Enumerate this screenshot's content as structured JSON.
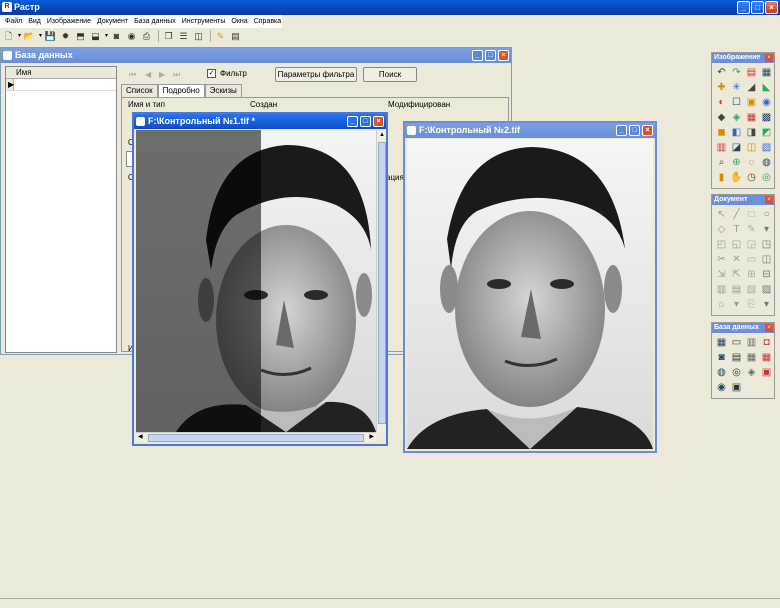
{
  "app": {
    "title": "Растр"
  },
  "menu": [
    "Файл",
    "Вид",
    "Изображение",
    "Документ",
    "База данных",
    "Инструменты",
    "Окна",
    "Справка"
  ],
  "toolbar_icons": [
    "new-file-icon",
    "open-file-icon",
    "save-icon",
    "scan-icon",
    "import-icon",
    "export-icon",
    "camera-icon",
    "disk-icon",
    "print-icon",
    "cascade-windows-icon",
    "tile-horizontal-icon",
    "tile-vertical-icon",
    "help-icon",
    "book-icon"
  ],
  "db_window": {
    "title": "База данных",
    "list_header": "Имя",
    "filter_label": "Фильтр",
    "filter_checked": true,
    "filter_params_button": "Параметры фильтра",
    "search_button": "Поиск",
    "tabs": [
      "Список",
      "Подробно",
      "Эскизы"
    ],
    "active_tab": 1,
    "fields": {
      "name_type": "Имя и тип",
      "created": "Создан",
      "modified": "Модифицирован",
      "partial_c1": "С",
      "partial_c2": "С",
      "partial_ation": "ация",
      "partial_i": "И"
    }
  },
  "image_window_1": {
    "title": "F:\\Контрольный №1.tif *"
  },
  "image_window_2": {
    "title": "F:\\Контрольный №2.tif"
  },
  "panels": {
    "image": {
      "title": "Изображение"
    },
    "document": {
      "title": "Документ"
    },
    "database": {
      "title": "База данных"
    }
  },
  "colors": {
    "titlebar": "#0845b8",
    "inactive_title": "#6a8ed6",
    "close_red": "#d8542c",
    "face": "#ece9d8"
  }
}
